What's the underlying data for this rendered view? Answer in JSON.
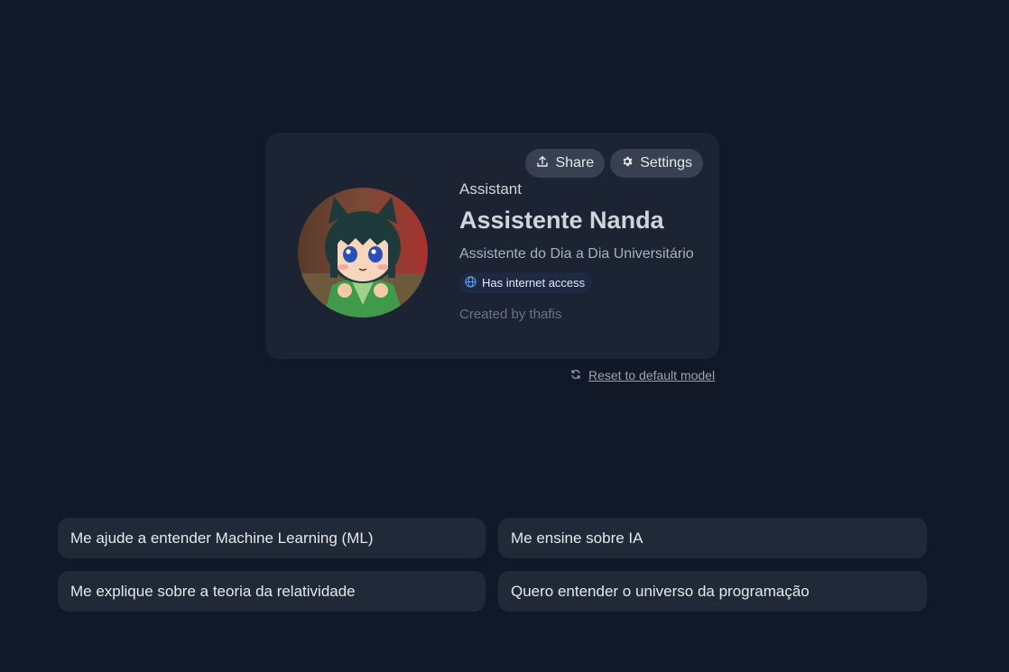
{
  "card": {
    "share_label": "Share",
    "settings_label": "Settings",
    "type_label": "Assistant",
    "name": "Assistente Nanda",
    "description": "Assistente do Dia a Dia Universitário",
    "badge": "Has internet access",
    "creator": "Created by thafis",
    "icons": {
      "share": "upload-icon",
      "settings": "gear-icon",
      "badge": "globe-icon"
    }
  },
  "reset": {
    "label": "Reset to default model",
    "icon": "refresh-icon"
  },
  "prompts": [
    "Me ajude a entender Machine Learning (ML)",
    "Me ensine sobre IA",
    "Me explique sobre a teoria da relatividade",
    "Quero entender o universo da programação"
  ],
  "colors": {
    "background": "#111827",
    "card": "#1c2433",
    "button": "#374151",
    "prompt": "#1f2937",
    "badge": "#1e2a44",
    "accent_blue": "#60a5fa"
  }
}
